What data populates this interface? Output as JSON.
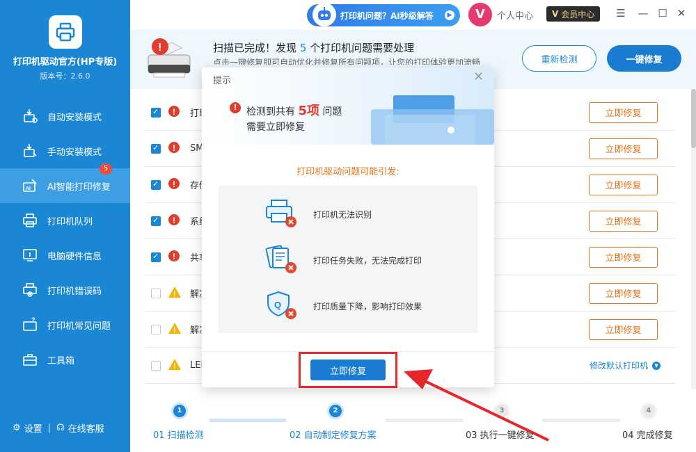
{
  "app": {
    "title": "打印机驱动官方(HP专版)",
    "version": "版本号：2.6.0"
  },
  "sidebar": {
    "items": [
      {
        "label": "自动安装模式",
        "icon": "auto-install-icon"
      },
      {
        "label": "手动安装模式",
        "icon": "manual-install-icon"
      },
      {
        "label": "AI智能打印修复",
        "icon": "ai-repair-icon",
        "badge": "5",
        "active": true
      },
      {
        "label": "打印机队列",
        "icon": "printer-queue-icon"
      },
      {
        "label": "电脑硬件信息",
        "icon": "hardware-info-icon"
      },
      {
        "label": "打印机错误码",
        "icon": "error-code-icon"
      },
      {
        "label": "打印机常见问题",
        "icon": "faq-icon"
      },
      {
        "label": "工具箱",
        "icon": "toolbox-icon"
      }
    ],
    "footer": {
      "settings": "设置",
      "separator": "|",
      "support": "在线客服"
    }
  },
  "titlebar": {
    "ai_pill": "打印机问题？AI秒级解答",
    "v_logo": "V",
    "personal": "个人中心",
    "member_mark": "V",
    "member": "会员中心",
    "menu": "☰",
    "minimize": "—",
    "maximize": "☐",
    "close": "✕"
  },
  "header": {
    "title_prefix": "扫描已完成！发现 ",
    "title_count": "5",
    "title_suffix": " 个打印机问题需要处理",
    "desc": "点击一键修复即可自动优化并修复所有问题项，让您的打印体验更加流畅",
    "recheck": "重新检测",
    "fix_all": "一键修复"
  },
  "list": {
    "rows": [
      {
        "text": "打印",
        "status": "error",
        "checked": true,
        "action": "立即修复"
      },
      {
        "text": "SM",
        "status": "error",
        "checked": true,
        "action": "立即修复"
      },
      {
        "text": "存储",
        "status": "error",
        "checked": true,
        "action": "立即修复"
      },
      {
        "text": "系统",
        "status": "error",
        "checked": true,
        "action": "立即修复"
      },
      {
        "text": "共享",
        "status": "error",
        "checked": true,
        "action": "立即修复"
      },
      {
        "text": "解决",
        "status": "warning",
        "checked": false,
        "action": "立即修复"
      },
      {
        "text": "解决",
        "status": "warning",
        "checked": false,
        "action": "立即修复"
      },
      {
        "text": "LEN",
        "status": "warning",
        "checked": false,
        "action": "修改默认打印机"
      }
    ]
  },
  "steps": [
    {
      "num": "1",
      "label": "01 扫描检测",
      "done": true
    },
    {
      "num": "2",
      "label": "02 自动制定修复方案",
      "done": true
    },
    {
      "num": "3",
      "label": "03 执行一键修复",
      "done": false
    },
    {
      "num": "4",
      "label": "04 完成修复",
      "done": false
    }
  ],
  "modal": {
    "title": "提示",
    "close": "✕",
    "headline_prefix": "检测到共有 ",
    "headline_count": "5项",
    "headline_suffix": " 问题",
    "headline_line2": "需要立即修复",
    "sub": "打印机驱动问题可能引发:",
    "causes": [
      {
        "text": "打印机无法识别",
        "icon": "printer-error-icon"
      },
      {
        "text": "打印任务失败，无法完成打印",
        "icon": "document-error-icon"
      },
      {
        "text": "打印质量下降，影响打印效果",
        "icon": "quality-shield-icon"
      }
    ],
    "fix_now": "立即修复"
  },
  "colors": {
    "sidebar": "#1a86d4",
    "primary": "#1a7cd0",
    "error": "#e23c2c",
    "warning": "#f5b400",
    "action": "#e4741a",
    "annotation": "#e5262b"
  }
}
